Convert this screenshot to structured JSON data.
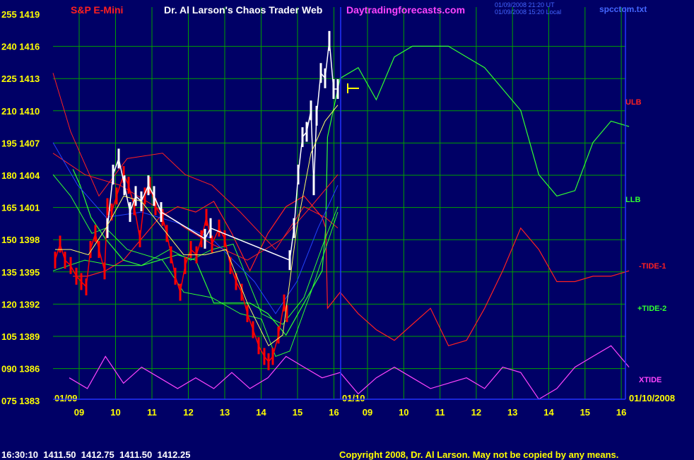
{
  "header": {
    "symbol": "S&P E-Mini",
    "title": "Dr. Al Larson's Chaos Trader Web",
    "site": "Daytradingforecasts.com",
    "filename": "spcctom.txt",
    "stamp_line1": "01/09/2008 21:20 UT",
    "stamp_line2": "01/09/2008 15:20 Local"
  },
  "footer": {
    "quote": "16:30:10  1411.50  1412.75  1411.50  1412.25",
    "copyright": "Copyright 2008, Dr. Al Larson. May not be copied by any means."
  },
  "colors": {
    "background": "#000066",
    "grid": "#00a000",
    "tick_text": "#ffff00",
    "title_red": "#ff2020",
    "title_white": "#ffffff",
    "site_magenta": "#ff44ff",
    "price_red": "#ff0000",
    "price_white": "#ffffff",
    "xtide": "#ff44ff",
    "tide1": "#ff2020",
    "tide2": "#30ff30",
    "divider": "#2233ff"
  },
  "chart_data": {
    "type": "line",
    "y_left_labels": [
      "255",
      "240",
      "225",
      "210",
      "195",
      "180",
      "165",
      "150",
      "135",
      "120",
      "105",
      "090",
      "075"
    ],
    "y_right_labels": [
      "1419",
      "1416",
      "1413",
      "1410",
      "1407",
      "1404",
      "1401",
      "1398",
      "1395",
      "1392",
      "1389",
      "1386",
      "1383"
    ],
    "ylim_price": [
      1383,
      1419
    ],
    "ylim_index": [
      75,
      255
    ],
    "x_hour_labels": [
      "09",
      "10",
      "11",
      "12",
      "13",
      "14",
      "15",
      "16",
      "09",
      "10",
      "11",
      "12",
      "13",
      "14",
      "15",
      "16"
    ],
    "date_labels": [
      "01/09",
      "01/10",
      "01/10/2008"
    ],
    "right_labels": [
      "ULB",
      "LLB",
      "-TIDE-1",
      "+TIDE-2",
      "XTIDE"
    ],
    "series": [
      {
        "name": "-TIDE-1",
        "x": [
          0.1,
          0.5,
          1,
          1.5,
          2,
          2.5,
          3,
          3.5,
          4,
          4.5,
          5,
          5.5,
          6,
          6.5,
          7,
          7.1,
          7.15,
          7.5,
          8,
          8.5,
          9,
          9.5,
          10,
          10.5,
          11,
          11.5,
          12,
          12.5,
          13,
          13.5,
          14,
          14.5,
          15,
          15.5
        ],
        "y": [
          1394.5,
          1394.5,
          1395,
          1396,
          1398,
          1400,
          1401,
          1400.5,
          1401.5,
          1398.5,
          1395,
          1398.5,
          1401,
          1402,
          1400,
          1399,
          1391.5,
          1393,
          1391,
          1389.5,
          1388.5,
          1390,
          1391.5,
          1388,
          1388.5,
          1391.5,
          1395,
          1399,
          1397,
          1394,
          1394,
          1394.5,
          1394.5,
          1395
        ]
      },
      {
        "name": "+TIDE-2",
        "x": [
          0.1,
          0.3,
          0.6,
          1,
          1.5,
          2,
          2.5,
          3,
          3.5,
          4,
          4.5,
          5,
          5.5,
          6,
          6.5,
          7,
          7.1,
          7.15,
          7.5,
          8,
          8.5,
          9,
          9.5,
          10,
          10.5,
          11,
          11.5,
          12,
          12.5,
          13,
          13.5,
          14,
          14.5,
          15,
          15.5
        ],
        "y": [
          1404.5,
          1403,
          1400,
          1398,
          1396,
          1395.5,
          1396,
          1396.5,
          1396,
          1392,
          1392,
          1392,
          1391,
          1389,
          1392,
          1395,
          1399,
          1407.5,
          1413,
          1414,
          1411,
          1415,
          1416,
          1416,
          1416,
          1415,
          1414,
          1412,
          1410,
          1404,
          1402,
          1402.5,
          1407,
          1409,
          1408.5
        ]
      },
      {
        "name": "XTIDE",
        "x": [
          0,
          0.5,
          1,
          1.5,
          2,
          2.5,
          3,
          3.5,
          4,
          4.5,
          5,
          5.5,
          6,
          6.5,
          7,
          7.5,
          8,
          8.5,
          9,
          9.5,
          10,
          10.5,
          11,
          11.5,
          12,
          12.5,
          13,
          13.5,
          14,
          14.5,
          15,
          15.5
        ],
        "y": [
          1385,
          1384,
          1387,
          1384.5,
          1386,
          1385,
          1384,
          1385,
          1384,
          1385.5,
          1384,
          1385,
          1387,
          1386,
          1385,
          1385.5,
          1383.5,
          1385,
          1386,
          1385,
          1384,
          1384.5,
          1385,
          1384,
          1386,
          1385.5,
          1383,
          1384,
          1386,
          1387,
          1388,
          1386
        ]
      }
    ]
  }
}
